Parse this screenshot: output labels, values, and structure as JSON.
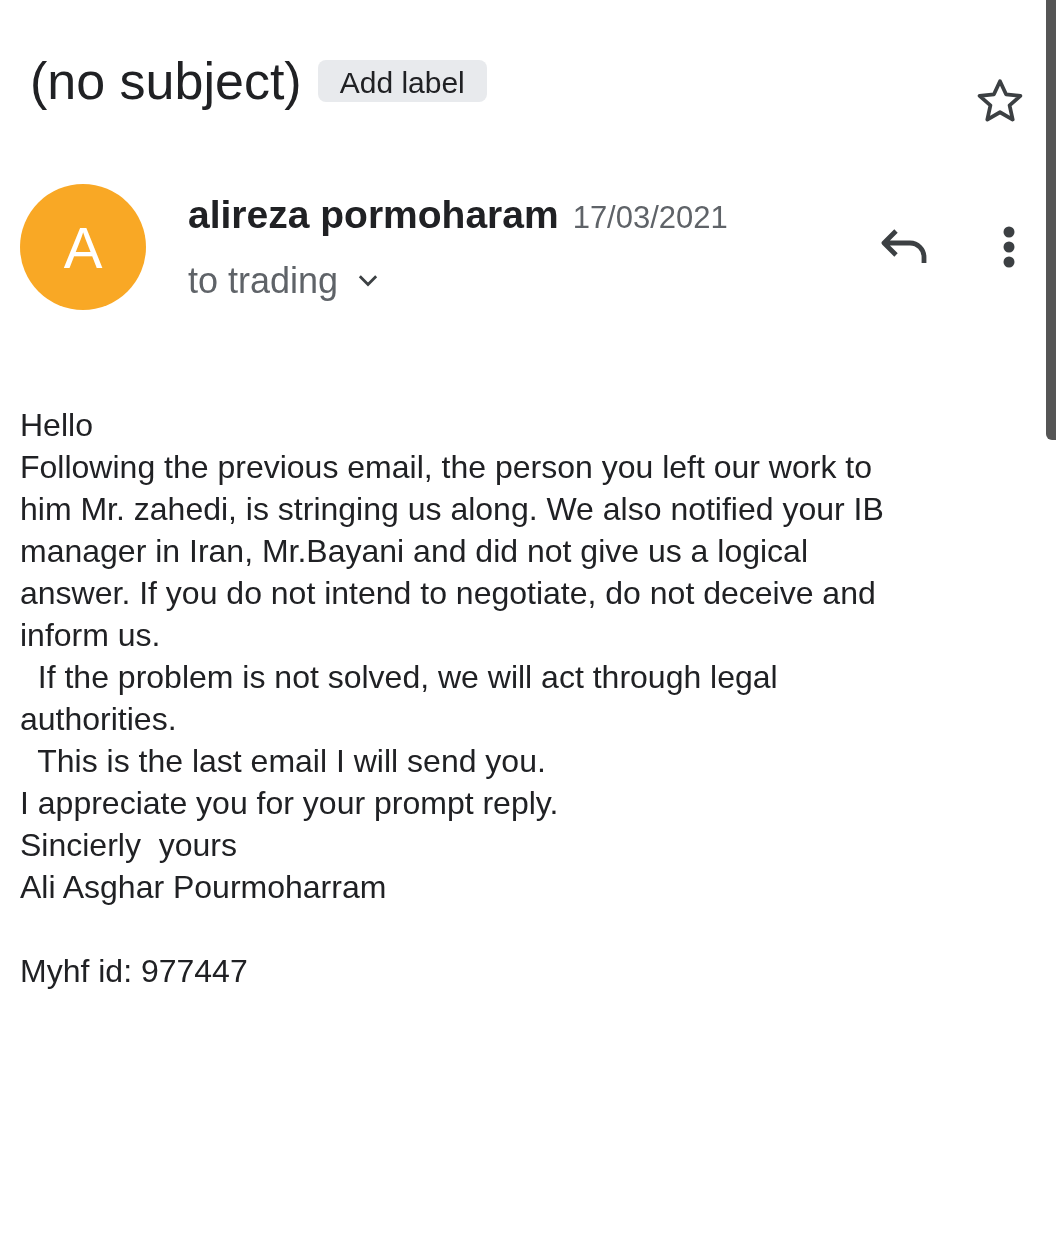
{
  "subject": "(no subject)",
  "label_button": "Add label",
  "starred": false,
  "sender": {
    "initial": "A",
    "name": "alireza pormoharam",
    "date": "17/03/2021",
    "recipient": "to trading",
    "details_expanded": false
  },
  "body": [
    {
      "text": "Hello"
    },
    {
      "text": "Following the previous email, the person you left our work to"
    },
    {
      "text": "him Mr. zahedi, is stringing us along. We also notified your IB"
    },
    {
      "text": "manager in Iran, Mr.Bayani and did not give us a logical"
    },
    {
      "text": "answer. If you do not intend to negotiate, do not deceive and"
    },
    {
      "text": "inform us."
    },
    {
      "text": "  If the problem is not solved, we will act through legal"
    },
    {
      "text": "authorities."
    },
    {
      "text": "  This is the last email I will send you."
    },
    {
      "text": "I appreciate you for your prompt reply."
    },
    {
      "text": "Sincierly  yours"
    },
    {
      "text": "Ali Asghar Pourmoharram"
    }
  ],
  "id_line": "Myhf id: 977447"
}
